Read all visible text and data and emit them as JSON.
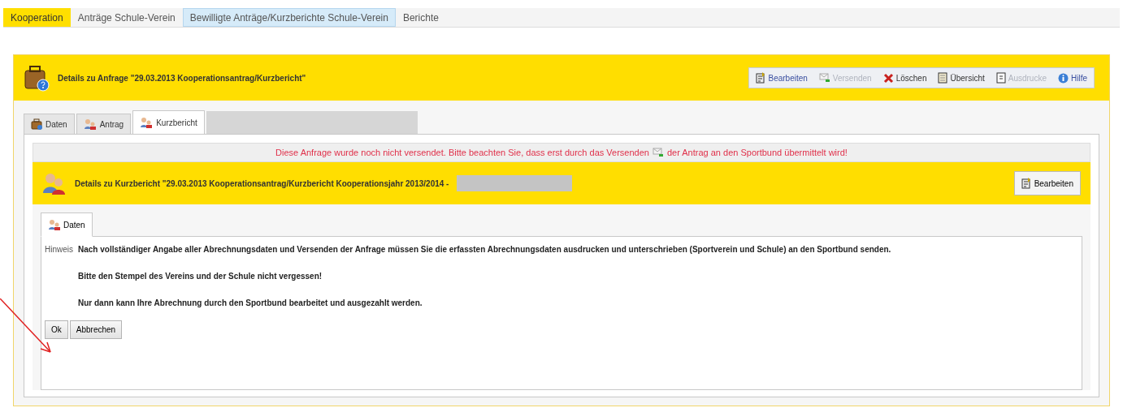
{
  "nav": [
    {
      "label": "Kooperation",
      "selected": true,
      "highlighted": false
    },
    {
      "label": "Anträge Schule-Verein",
      "selected": false,
      "highlighted": false
    },
    {
      "label": "Bewilligte Anträge/Kurzberichte Schule-Verein",
      "selected": false,
      "highlighted": true
    },
    {
      "label": "Berichte",
      "selected": false,
      "highlighted": false
    }
  ],
  "header": {
    "title": "Details zu  Anfrage \"29.03.2013 Kooperationsantrag/Kurzbericht\""
  },
  "toolbar": [
    {
      "kind": "edit",
      "label": "Bearbeiten",
      "disabled": false
    },
    {
      "kind": "send",
      "label": "Versenden",
      "disabled": true
    },
    {
      "kind": "delete",
      "label": "Löschen",
      "disabled": false
    },
    {
      "kind": "overview",
      "label": "Übersicht",
      "disabled": false
    },
    {
      "kind": "print",
      "label": "Ausdrucke",
      "disabled": true
    },
    {
      "kind": "help",
      "label": "Hilfe",
      "disabled": false
    }
  ],
  "tabs": [
    {
      "kind": "case",
      "label": "Daten",
      "selected": false
    },
    {
      "kind": "people",
      "label": "Antrag",
      "selected": false
    },
    {
      "kind": "people",
      "label": "Kurzbericht",
      "selected": true
    }
  ],
  "notice": {
    "before": "Diese Anfrage wurde noch nicht versendet. Bitte beachten Sie, dass erst durch das Versenden",
    "after": "der Antrag an den Sportbund übermittelt wird!"
  },
  "report": {
    "title": "Details zu Kurzbericht \"29.03.2013 Kooperationsantrag/Kurzbericht Kooperationsjahr 2013/2014 -",
    "button": "Bearbeiten"
  },
  "inner_tabs": [
    {
      "label": "Daten",
      "selected": true
    }
  ],
  "content": {
    "label": "Hinweis",
    "paragraphs": [
      "Nach vollständiger Angabe aller Abrechnungsdaten und Versenden der Anfrage müssen Sie die erfassten Abrechnungsdaten ausdrucken und unterschrieben (Sportverein und Schule) an den Sportbund senden.",
      "Bitte den Stempel des Vereins und der Schule nicht vergessen!",
      "Nur dann kann Ihre Abrechnung durch den Sportbund bearbeitet und ausgezahlt werden."
    ]
  },
  "buttons": [
    "Ok",
    "Abbrechen"
  ]
}
